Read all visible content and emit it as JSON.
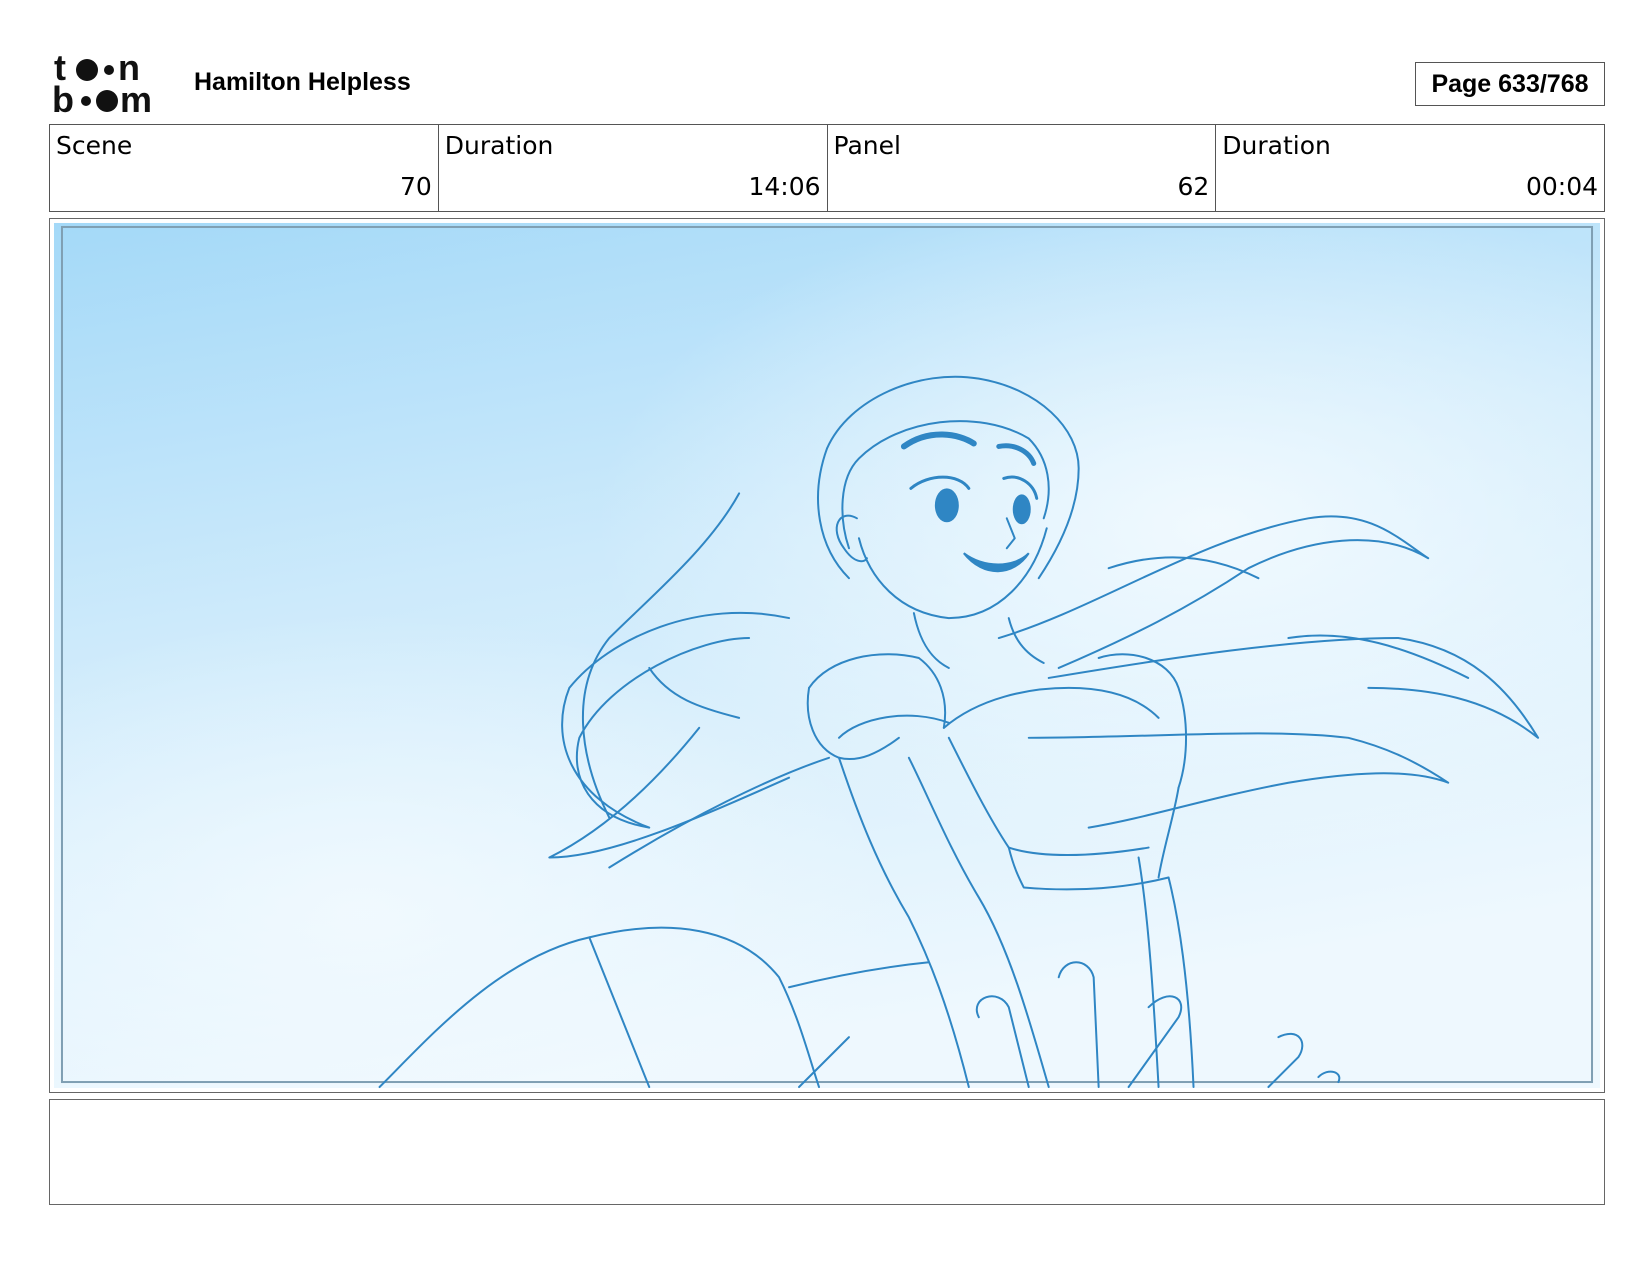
{
  "header": {
    "logo_alt": "toon boom",
    "project_title": "Hamilton Helpless",
    "page_label": "Page 633/768"
  },
  "info": {
    "scene_label": "Scene",
    "scene_value": "70",
    "scene_duration_label": "Duration",
    "scene_duration_value": "14:06",
    "panel_label": "Panel",
    "panel_value": "62",
    "panel_duration_label": "Duration",
    "panel_duration_value": "00:04"
  },
  "panel": {
    "image": "storyboard-sketch-girl-sky"
  },
  "colors": {
    "sky_light": "#eaf6fd",
    "sky_mid": "#bfe3fa",
    "sky_dark": "#9fd6f7",
    "line": "#2f86c4"
  }
}
